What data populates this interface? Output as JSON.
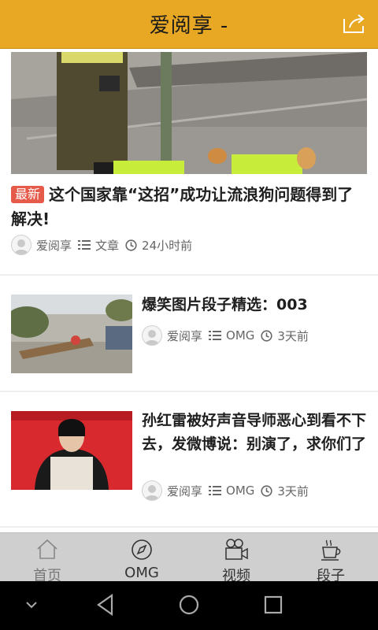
{
  "header": {
    "title": "爱阅享 -"
  },
  "hero": {
    "tag": "最新",
    "title": "这个国家靠“这招”成功让流浪狗问题得到了解决!",
    "author": "爱阅享",
    "category": "文章",
    "time": "24小时前"
  },
  "articles": [
    {
      "title": "爆笑图片段子精选：003",
      "author": "爱阅享",
      "category": "OMG",
      "time": "3天前"
    },
    {
      "title": "孙红雷被好声音导师恶心到看不下去，发微博说：别演了，求你们了",
      "author": "爱阅享",
      "category": "OMG",
      "time": "3天前"
    }
  ],
  "tabs": [
    {
      "label": "首页",
      "icon": "home-icon"
    },
    {
      "label": "OMG",
      "icon": "compass-icon"
    },
    {
      "label": "视频",
      "icon": "video-camera-icon"
    },
    {
      "label": "段子",
      "icon": "coffee-cup-icon"
    }
  ],
  "colors": {
    "header_bg": "#e8a824",
    "tag_bg": "#e65a4a",
    "tabbar_bg": "#cfcfcf"
  }
}
